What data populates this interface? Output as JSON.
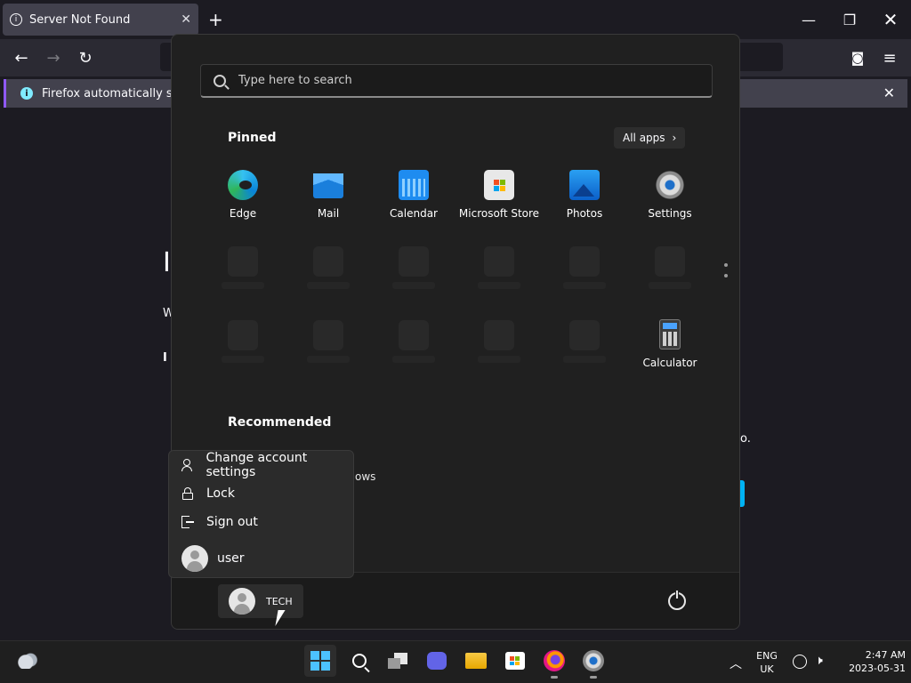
{
  "browser": {
    "tab_title": "Server Not Found",
    "notification_text": "Firefox automatically sends"
  },
  "page_fragments": [
    "I",
    "W",
    "I",
    "ows",
    "o."
  ],
  "start_menu": {
    "search_placeholder": "Type here to search",
    "pinned_title": "Pinned",
    "all_apps_label": "All apps",
    "pinned_apps": [
      {
        "label": "Edge",
        "icon": "edge-icon"
      },
      {
        "label": "Mail",
        "icon": "mail-icon"
      },
      {
        "label": "Calendar",
        "icon": "calendar-icon"
      },
      {
        "label": "Microsoft Store",
        "icon": "store-icon"
      },
      {
        "label": "Photos",
        "icon": "photos-icon"
      },
      {
        "label": "Settings",
        "icon": "settings-icon"
      },
      {
        "label": "Calculator",
        "icon": "calculator-icon"
      }
    ],
    "recommended_title": "Recommended",
    "user_button_label": "TECH"
  },
  "account_flyout": {
    "items": [
      {
        "label": "Change account settings",
        "icon": "account-settings-icon"
      },
      {
        "label": "Lock",
        "icon": "lock-icon"
      },
      {
        "label": "Sign out",
        "icon": "sign-out-icon"
      }
    ],
    "user_label": "user"
  },
  "taskbar": {
    "language_line1": "ENG",
    "language_line2": "UK",
    "time": "2:47 AM",
    "date": "2023-05-31"
  },
  "colors": {
    "accent": "#9059ff",
    "start_bg": "#202020",
    "taskbar_bg": "#1f1f1f"
  }
}
